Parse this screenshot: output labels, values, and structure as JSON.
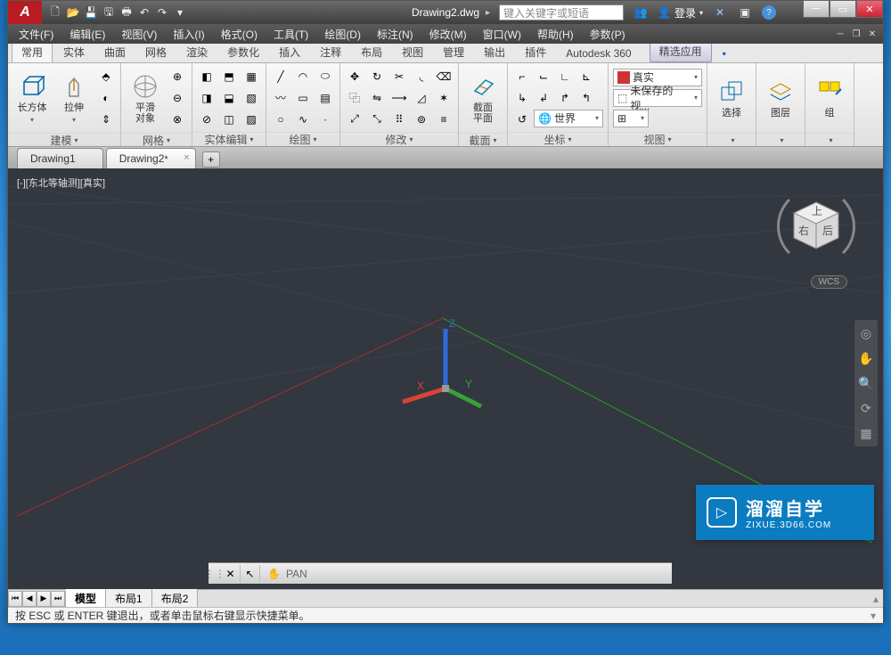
{
  "title": "Drawing2.dwg",
  "search_placeholder": "键入关键字或短语",
  "login_label": "登录",
  "menus": [
    "文件(F)",
    "编辑(E)",
    "视图(V)",
    "插入(I)",
    "格式(O)",
    "工具(T)",
    "绘图(D)",
    "标注(N)",
    "修改(M)",
    "窗口(W)",
    "帮助(H)",
    "参数(P)"
  ],
  "ribbon_tabs": [
    "常用",
    "实体",
    "曲面",
    "网格",
    "渲染",
    "参数化",
    "插入",
    "注释",
    "布局",
    "视图",
    "管理",
    "输出",
    "插件",
    "Autodesk 360",
    "精选应用"
  ],
  "ribbon_ext": "•",
  "panels": {
    "modeling": {
      "label": "建模",
      "btn1": "长方体",
      "btn2": "拉伸"
    },
    "mesh": {
      "label": "网格",
      "btn": "平滑\n对象"
    },
    "solid_edit": {
      "label": "实体编辑"
    },
    "draw": {
      "label": "绘图"
    },
    "modify": {
      "label": "修改"
    },
    "section": {
      "label": "截面",
      "btn": "截面\n平面"
    },
    "coords": {
      "label": "坐标",
      "world": "世界"
    },
    "view": {
      "label": "视图",
      "real": "真实",
      "unsaved": "未保存的视..."
    },
    "select": {
      "label": "选择",
      "btn": "选择"
    },
    "layers": {
      "label": "图层",
      "btn": "图层"
    },
    "group": {
      "label": "组",
      "btn": "组"
    }
  },
  "file_tabs": [
    {
      "name": "Drawing1",
      "active": false,
      "dirty": false
    },
    {
      "name": "Drawing2",
      "active": true,
      "dirty": true
    }
  ],
  "viewport_label": "[-][东北等轴测][真实]",
  "wcs": "WCS",
  "axes": {
    "x": "X",
    "y": "Y",
    "z": "Z"
  },
  "command": {
    "text": "PAN"
  },
  "layout_tabs": [
    "模型",
    "布局1",
    "布局2"
  ],
  "hint": "按 ESC 或 ENTER 键退出，或者单击鼠标右键显示快捷菜单。",
  "watermark": {
    "title": "溜溜自学",
    "sub": "ZIXUE.3D66.COM"
  }
}
